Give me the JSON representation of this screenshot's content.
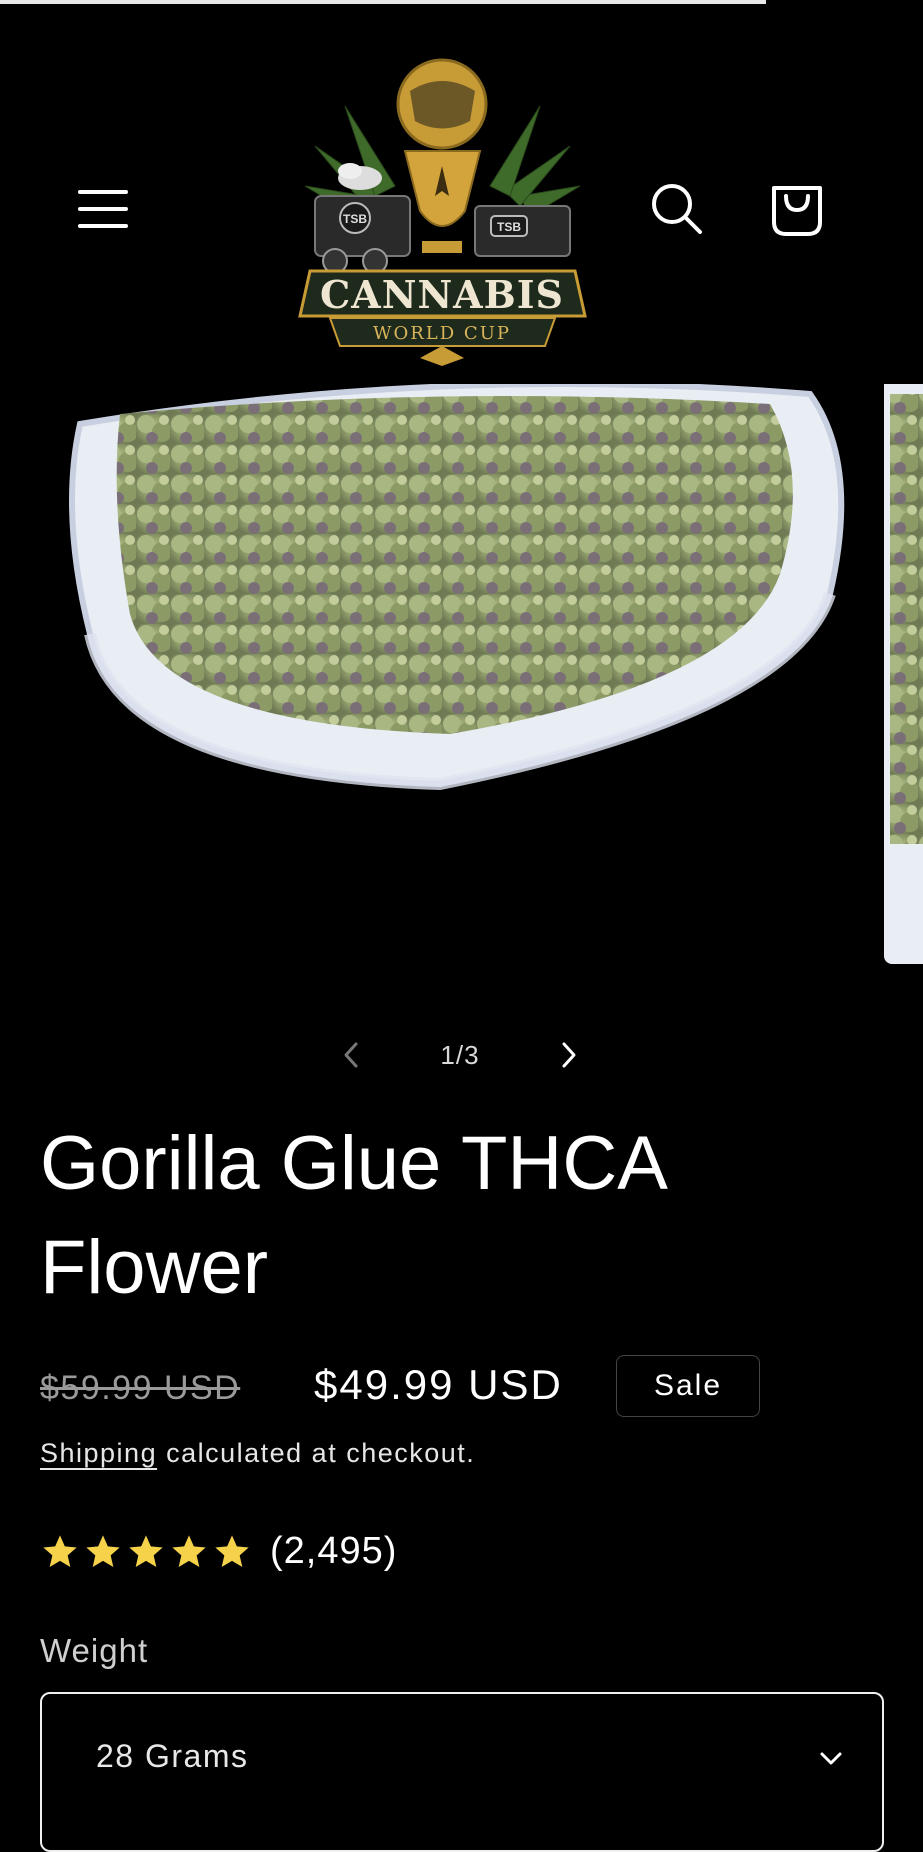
{
  "load_progress": 0.83,
  "header": {
    "logo": {
      "title": "CANNABIS",
      "subtitle": "WORLD CUP",
      "badge_left": "TSB",
      "badge_right": "TSB"
    },
    "icons": [
      "menu-icon",
      "search-icon",
      "cart-icon"
    ]
  },
  "gallery": {
    "current": "1/3",
    "icons": [
      "chevron-left-icon",
      "chevron-right-icon"
    ]
  },
  "product": {
    "title": "Gorilla Glue THCA Flower",
    "compare_price": "$59.99 USD",
    "price": "$49.99 USD",
    "sale_badge": "Sale",
    "shipping_link": "Shipping",
    "shipping_text": " calculated at checkout.",
    "rating": 5,
    "review_count": "(2,495)",
    "star_color": "#f5d24a"
  },
  "options": {
    "weight_label": "Weight",
    "weight_value": "28 Grams"
  }
}
